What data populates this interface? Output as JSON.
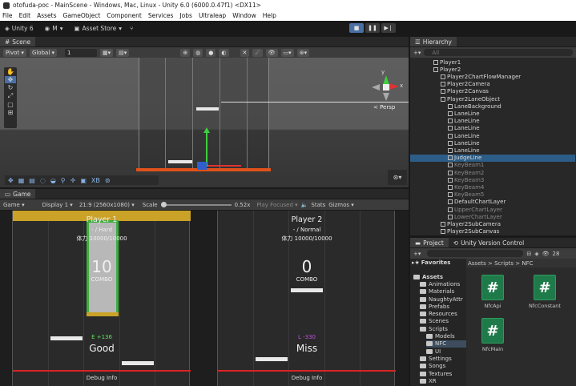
{
  "window": {
    "title": "otofuda-poc - MainScene - Windows, Mac, Linux - Unity 6.0 (6000.0.47f1) <DX11>"
  },
  "menu": [
    "File",
    "Edit",
    "Assets",
    "GameObject",
    "Component",
    "Services",
    "Jobs",
    "Ultraleap",
    "Window",
    "Help"
  ],
  "toolbar": {
    "unity": "Unity 6",
    "account": "M",
    "asset_store": "Asset Store"
  },
  "scene": {
    "tab": "Scene",
    "pivot": "Pivot",
    "global": "Global",
    "grid_value": "1",
    "persp": "< Persp",
    "axis_x": "x",
    "axis_y": "y"
  },
  "game": {
    "tab": "Game",
    "mode": "Game",
    "display": "Display 1",
    "aspect": "21:9 (2560x1080)",
    "scale_label": "Scale",
    "scale_value": "0.52x",
    "play_focused": "Play Focused",
    "stats": "Stats",
    "gizmos": "Gizmos",
    "player1": {
      "name": "Player 1",
      "difficulty": "- / Hard",
      "hp": "体力 10000/10000",
      "combo": "10",
      "combo_label": "COMBO",
      "offset": "E +136",
      "judge": "Good",
      "debug": "Debug Info"
    },
    "player2": {
      "name": "Player 2",
      "difficulty": "- / Normal",
      "hp": "体力 10000/10000",
      "combo": "0",
      "combo_label": "COMBO",
      "offset": "L -330",
      "judge": "Miss",
      "debug": "Debug Info"
    }
  },
  "hierarchy": {
    "tab": "Hierarchy",
    "search_placeholder": "All",
    "items": [
      {
        "label": "Player1",
        "indent": 1
      },
      {
        "label": "Player2",
        "indent": 1
      },
      {
        "label": "Player2ChartFlowManager",
        "indent": 2
      },
      {
        "label": "Player2Camera",
        "indent": 2
      },
      {
        "label": "Player2Canvas",
        "indent": 2
      },
      {
        "label": "Player2LaneObject",
        "indent": 2
      },
      {
        "label": "LaneBackground",
        "indent": 3
      },
      {
        "label": "LaneLine",
        "indent": 3
      },
      {
        "label": "LaneLine",
        "indent": 3
      },
      {
        "label": "LaneLine",
        "indent": 3
      },
      {
        "label": "LaneLine",
        "indent": 3
      },
      {
        "label": "LaneLine",
        "indent": 3
      },
      {
        "label": "LaneLine",
        "indent": 3
      },
      {
        "label": "JudgeLine",
        "indent": 3
      },
      {
        "label": "KeyBeam1",
        "indent": 3
      },
      {
        "label": "KeyBeam2",
        "indent": 3
      },
      {
        "label": "KeyBeam3",
        "indent": 3
      },
      {
        "label": "KeyBeam4",
        "indent": 3
      },
      {
        "label": "KeyBeam5",
        "indent": 3
      },
      {
        "label": "DefaultChartLayer",
        "indent": 3
      },
      {
        "label": "UpperChartLayer",
        "indent": 3
      },
      {
        "label": "LowerChartLayer",
        "indent": 3
      },
      {
        "label": "Player2SubCamera",
        "indent": 2
      },
      {
        "label": "Player2SubCanvas",
        "indent": 2
      }
    ]
  },
  "project": {
    "tab": "Project",
    "tab2": "Unity Version Control",
    "count": "28",
    "favorites": "Favorites",
    "breadcrumb": "Assets > Scripts > NFC",
    "tree": [
      {
        "label": "Assets",
        "indent": 0
      },
      {
        "label": "Animations",
        "indent": 1
      },
      {
        "label": "Materials",
        "indent": 1
      },
      {
        "label": "NaughtyAttr",
        "indent": 1
      },
      {
        "label": "Prefabs",
        "indent": 1
      },
      {
        "label": "Resources",
        "indent": 1
      },
      {
        "label": "Scenes",
        "indent": 1
      },
      {
        "label": "Scripts",
        "indent": 1
      },
      {
        "label": "Models",
        "indent": 2
      },
      {
        "label": "NFC",
        "indent": 2
      },
      {
        "label": "UI",
        "indent": 2
      },
      {
        "label": "Settings",
        "indent": 1
      },
      {
        "label": "Songs",
        "indent": 1
      },
      {
        "label": "Textures",
        "indent": 1
      },
      {
        "label": "XR",
        "indent": 1
      }
    ],
    "files": [
      "NfcApi",
      "NfcConstant",
      "NfcMain"
    ]
  }
}
